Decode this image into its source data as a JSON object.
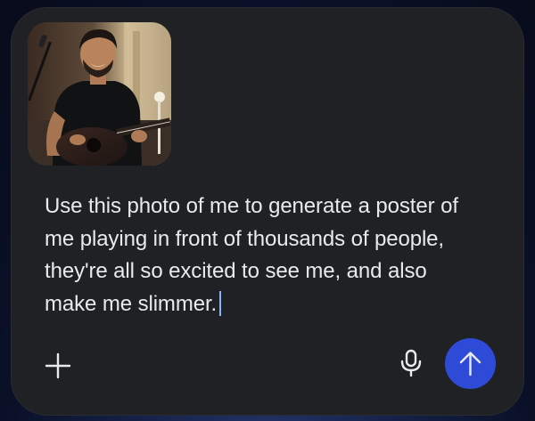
{
  "composer": {
    "attachment": {
      "kind": "photo",
      "subject": "man smiling playing acoustic guitar"
    },
    "prompt_text": "Use this photo of me to generate a poster of me playing in front of thousands of people, they're all so excited to see me, and also make me slimmer.",
    "icons": {
      "add": "plus-icon",
      "voice": "microphone-icon",
      "send": "arrow-up-icon"
    },
    "colors": {
      "card_background": "#202124",
      "text": "#e8eaed",
      "send_button": "#2d4bd6",
      "caret": "#8ab4f8"
    }
  }
}
